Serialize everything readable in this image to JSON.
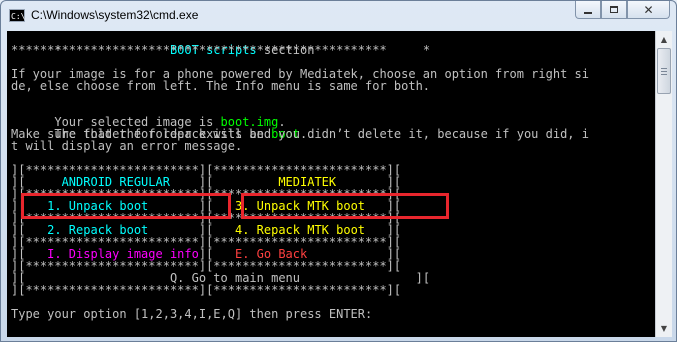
{
  "window": {
    "title": "C:\\Windows\\system32\\cmd.exe",
    "icon_label": "C:\\",
    "minimize_icon": "minimize-icon",
    "maximize_icon": "maximize-icon",
    "close_icon": "close-icon"
  },
  "console": {
    "header_line1": "*               BOOT scripts section               *",
    "header_line2": "****************************************************",
    "intro_line1": "If your image is for a phone powered by Mediatek, choose an option from right si",
    "intro_line2": "de, else choose from left. The Info menu is same for both.",
    "selected_prefix": "Your selected image is ",
    "selected_image": "boot.img",
    "selected_suffix": ".",
    "repack_prefix": "The folder for repack will be ",
    "repack_folder": "boot",
    "repack_suffix": ".",
    "warning_line1": "Make sure that the folder exists and you didn’t delete it, because if you did, i",
    "warning_line2": "t will display an error message.",
    "menu": {
      "border_full": "][************************][************************][",
      "left_edge": "][",
      "mid_edge": "][",
      "right_edge": "][",
      "android_regular": "ANDROID REGULAR",
      "mediatek": "MEDIATEK",
      "opt1": "1. Unpack boot",
      "opt2": "2. Repack boot",
      "opt3": "3. Unpack MTK boot",
      "opt4": "4. Repack MTK boot",
      "optI": "I. Display image info",
      "optE": "E. Go Back",
      "optQ": "Q. Go to main menu"
    },
    "prompt": "Type your option [1,2,3,4,I,E,Q] then press ENTER:"
  }
}
